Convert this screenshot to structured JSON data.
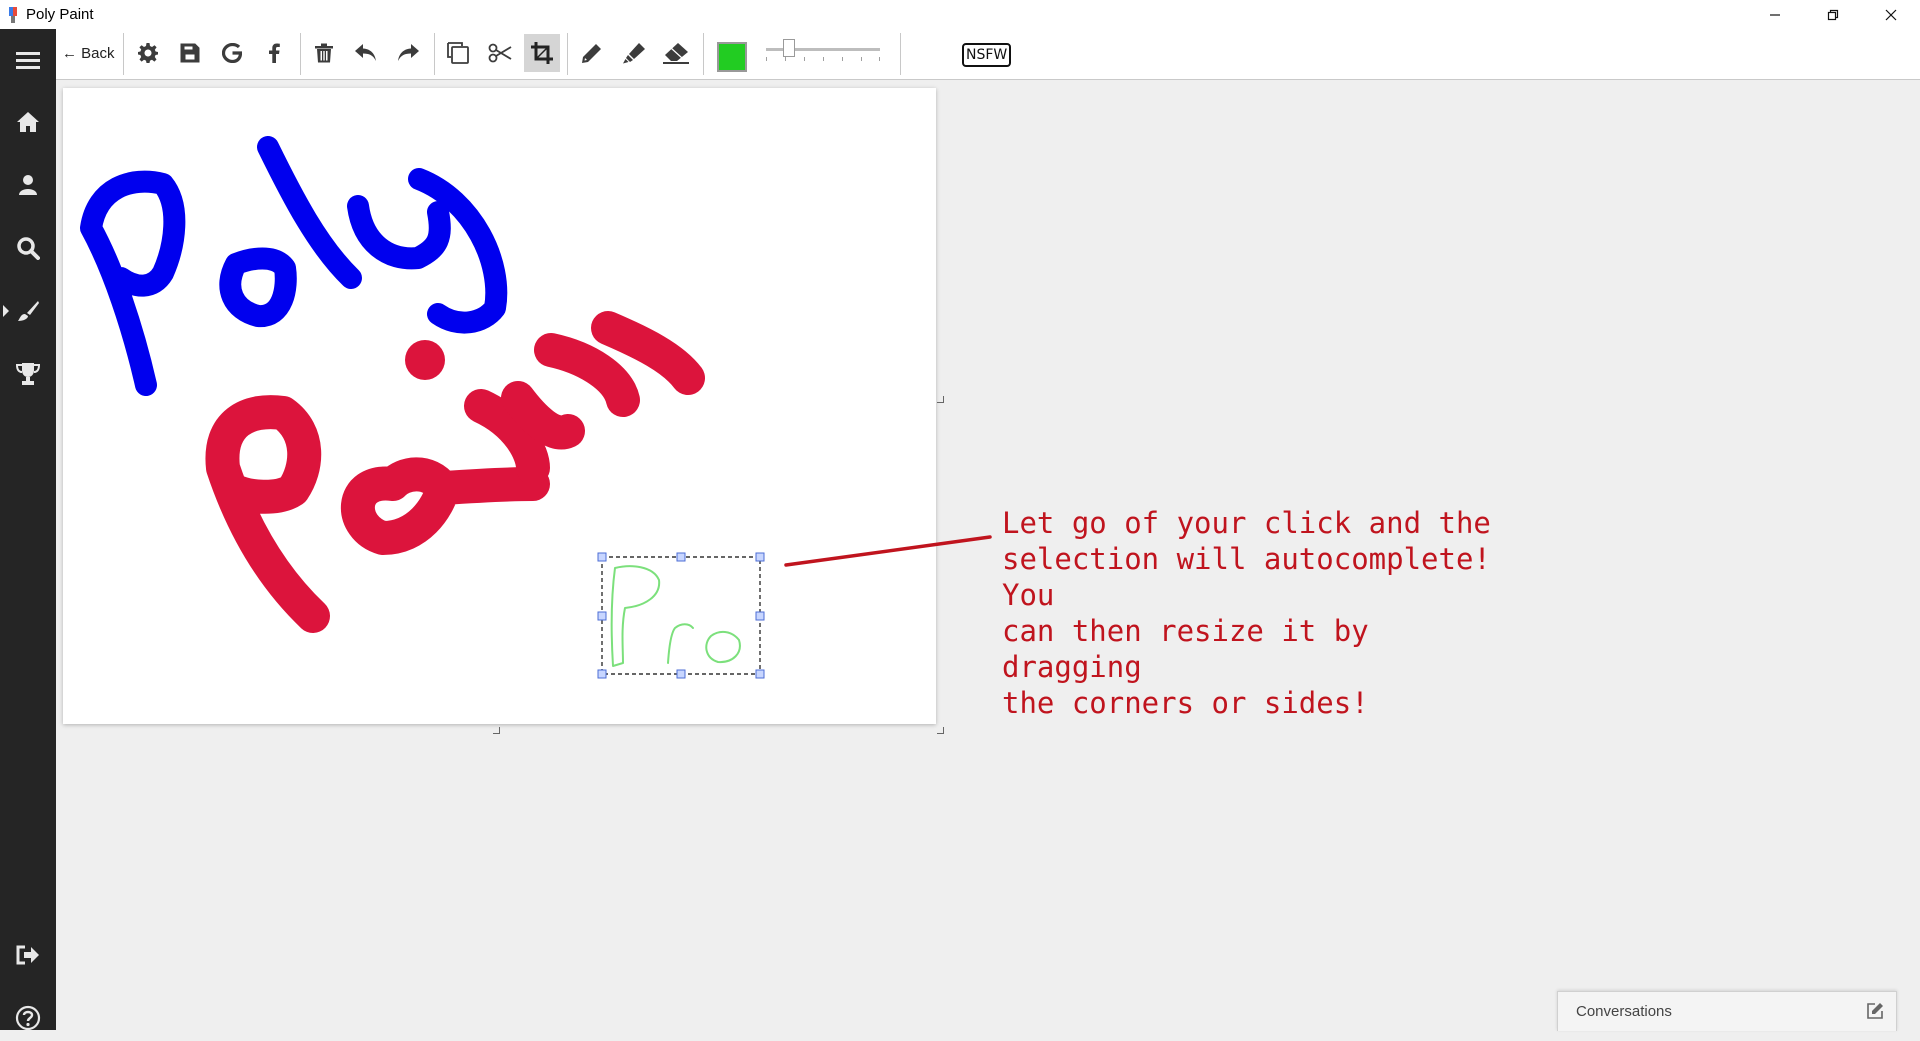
{
  "window": {
    "title": "Poly Paint",
    "controls": [
      "minimize-icon",
      "restore-icon",
      "close-icon"
    ]
  },
  "sidebar": {
    "items": [
      {
        "name": "menu",
        "icon": "hamburger-icon"
      },
      {
        "name": "home",
        "icon": "home-icon"
      },
      {
        "name": "profile",
        "icon": "user-icon"
      },
      {
        "name": "search",
        "icon": "search-icon"
      },
      {
        "name": "draw",
        "icon": "brush-icon",
        "active": true
      },
      {
        "name": "achievements",
        "icon": "trophy-icon"
      },
      {
        "name": "logout",
        "icon": "sign-out-icon"
      },
      {
        "name": "help",
        "icon": "help-icon"
      }
    ]
  },
  "toolbar": {
    "back_label": "← Back",
    "tools": [
      "gear-icon",
      "save-icon",
      "google-icon",
      "facebook-icon",
      "trash-icon",
      "undo-icon",
      "redo-icon",
      "duplicate-icon",
      "cut-icon",
      "crop-icon",
      "pencil-icon",
      "marker-icon",
      "eraser-icon"
    ],
    "active_tool": "crop-icon",
    "current_color": "#22cc22",
    "nsfw_label": "NSFW"
  },
  "annotation": {
    "text": "Let go of your click and the\nselection will autocomplete! You\ncan then resize it by dragging\nthe corners or sides!",
    "color": "#c0141e"
  },
  "conversations": {
    "label": "Conversations",
    "icon": "edit-icon"
  }
}
